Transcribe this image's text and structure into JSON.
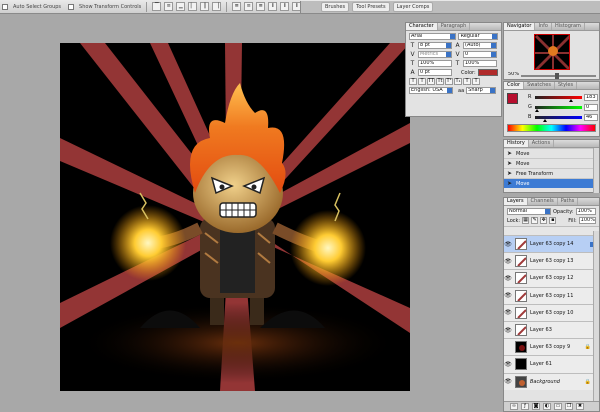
{
  "options_bar": {
    "auto_select": "Auto Select Groups",
    "show_transform": "Show Transform Controls",
    "well_tabs": [
      "Brushes",
      "Tool Presets",
      "Layer Comps"
    ]
  },
  "character": {
    "tabs": [
      "Character",
      "Paragraph"
    ],
    "font": "Arial",
    "style": "Regular",
    "size": "8 pt",
    "leading": "(Auto)",
    "kerning": "Metrics",
    "tracking": "0",
    "vscale": "100%",
    "hscale": "100%",
    "baseline": "0 pt",
    "color_label": "Color:",
    "type_buttons": [
      "T",
      "T",
      "TT",
      "Tt",
      "T¹",
      "T₁",
      "T",
      "T"
    ],
    "language": "English: USA",
    "aa_label": "aa",
    "antialias": "Sharp"
  },
  "navigator": {
    "tabs": [
      "Navigator",
      "Info",
      "Histogram"
    ],
    "zoom": "50%"
  },
  "color": {
    "tabs": [
      "Color",
      "Swatches",
      "Styles"
    ],
    "channels": [
      {
        "label": "R",
        "value": "183",
        "pct": 0.72
      },
      {
        "label": "G",
        "value": "0",
        "pct": 0.0
      },
      {
        "label": "B",
        "value": "46",
        "pct": 0.18
      }
    ],
    "fg": "#b70e2e"
  },
  "history": {
    "tabs": [
      "History",
      "Actions"
    ],
    "items": [
      "Move",
      "Move",
      "Free Transform",
      "Move"
    ]
  },
  "layers": {
    "tabs": [
      "Layers",
      "Channels",
      "Paths"
    ],
    "blend": "Normal",
    "opacity_label": "Opacity:",
    "opacity": "100%",
    "lock_label": "Lock:",
    "fill_label": "Fill:",
    "fill": "100%",
    "rows": [
      {
        "name": "Layer 63 copy 14",
        "selected": true
      },
      {
        "name": "Layer 63 copy 13",
        "selected": false
      },
      {
        "name": "Layer 63 copy 12",
        "selected": false
      },
      {
        "name": "Layer 63 copy 11",
        "selected": false
      },
      {
        "name": "Layer 63 copy 10",
        "selected": false
      },
      {
        "name": "Layer 63",
        "selected": false
      },
      {
        "name": "Layer 63 copy 9",
        "selected": false
      },
      {
        "name": "Layer 61",
        "selected": false
      },
      {
        "name": "Background",
        "selected": false
      }
    ]
  }
}
